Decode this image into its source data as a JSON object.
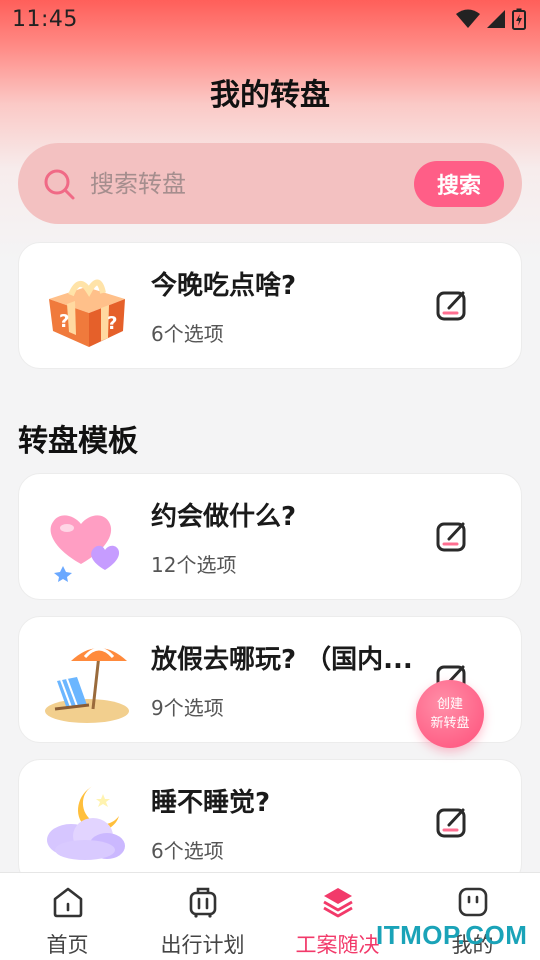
{
  "status_bar": {
    "time": "11:45"
  },
  "header": {
    "title": "我的转盘"
  },
  "search": {
    "placeholder": "搜索转盘",
    "button_label": "搜索"
  },
  "my_wheels": [
    {
      "title": "今晚吃点啥?",
      "subtitle": "6个选项",
      "image": "gift-box-icon"
    }
  ],
  "templates_section": {
    "title": "转盘模板",
    "items": [
      {
        "title": "约会做什么?",
        "subtitle": "12个选项",
        "image": "hearts-icon"
      },
      {
        "title": "放假去哪玩? （国内...",
        "subtitle": "9个选项",
        "image": "beach-chair-icon"
      },
      {
        "title": "睡不睡觉?",
        "subtitle": "6个选项",
        "image": "moon-cloud-icon"
      }
    ]
  },
  "fab": {
    "line1": "创建",
    "line2": "新转盘"
  },
  "tab_bar": {
    "items": [
      {
        "label": "首页",
        "icon": "home-icon"
      },
      {
        "label": "出行计划",
        "icon": "luggage-icon"
      },
      {
        "label": "工案随决",
        "icon": "layers-icon",
        "active": true
      },
      {
        "label": "我的",
        "icon": "profile-icon"
      }
    ]
  },
  "watermark": "ITMOP.COM",
  "colors": {
    "accent": "#ff5e87",
    "active_tab": "#f23a6a",
    "search_bg": "#f3c1c1"
  }
}
